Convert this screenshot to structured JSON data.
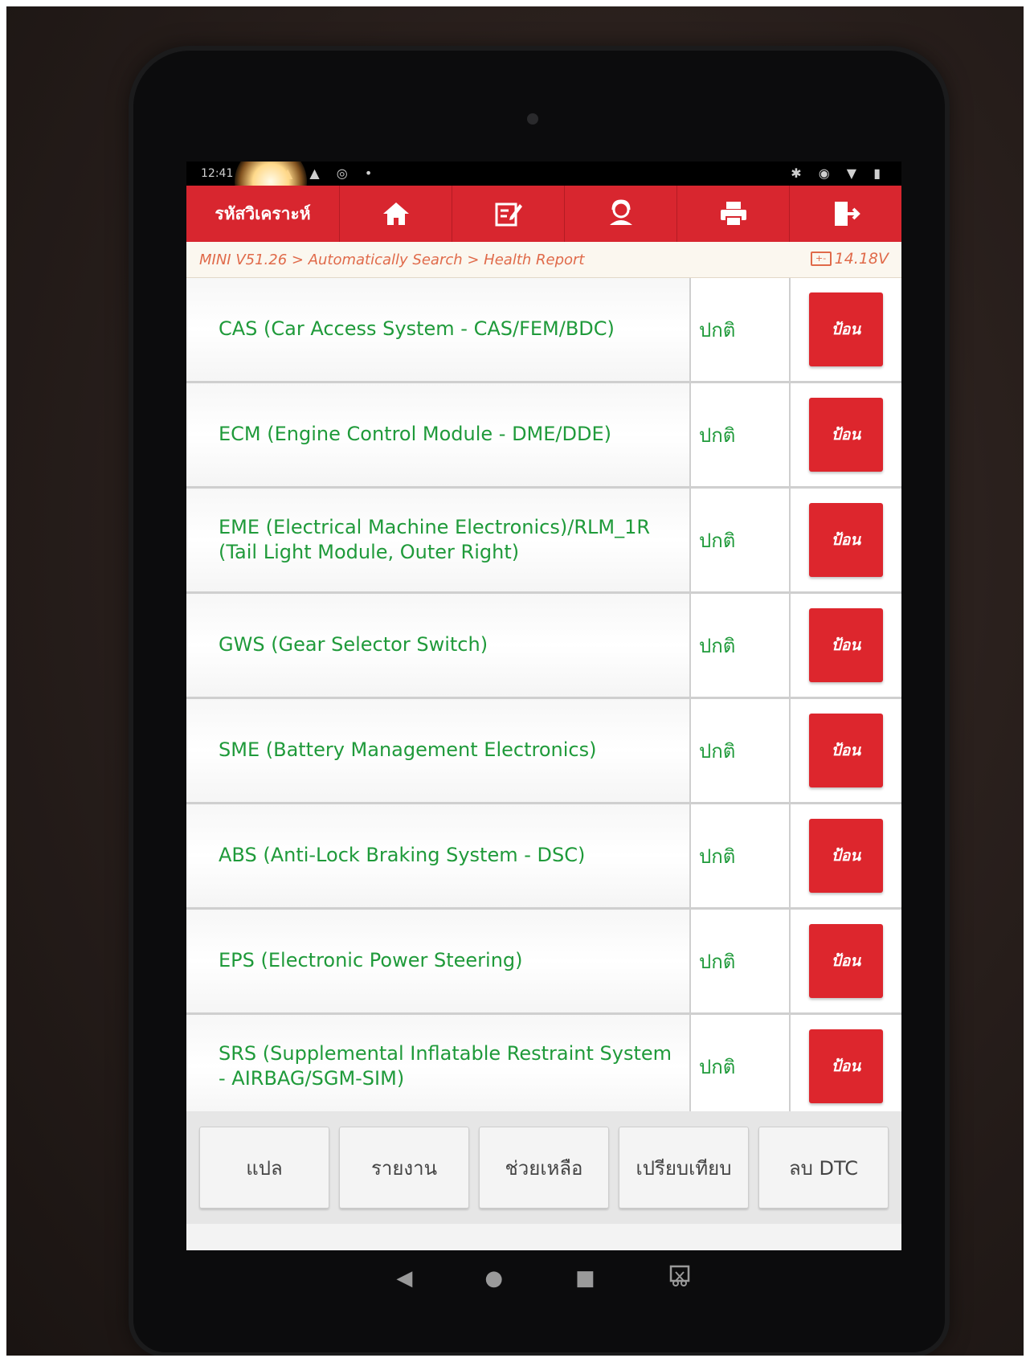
{
  "status_bar": {
    "time": "12:41",
    "left_icons": "▲ ▲ ◎ •",
    "right_icons": "✱ ◉ ▼ ▮"
  },
  "toolbar": {
    "title": "รหัสวิเคราะห์",
    "buttons": [
      {
        "icon": "home-icon"
      },
      {
        "icon": "edit-icon"
      },
      {
        "icon": "user-icon"
      },
      {
        "icon": "printer-icon"
      },
      {
        "icon": "exit-icon"
      }
    ],
    "colors": {
      "background": "#d8262f"
    }
  },
  "breadcrumb": {
    "path": "MINI V51.26 > Automatically Search > Health Report",
    "voltage": "14.18V",
    "battery_icon_text": "+-"
  },
  "systems": [
    {
      "name": "CAS (Car Access System - CAS/FEM/BDC)",
      "status": "ปกติ",
      "action": "ป้อน"
    },
    {
      "name": "ECM (Engine Control Module - DME/DDE)",
      "status": "ปกติ",
      "action": "ป้อน"
    },
    {
      "name": "EME (Electrical Machine Electronics)/RLM_1R (Tail Light Module, Outer Right)",
      "status": "ปกติ",
      "action": "ป้อน"
    },
    {
      "name": "GWS (Gear Selector Switch)",
      "status": "ปกติ",
      "action": "ป้อน"
    },
    {
      "name": "SME (Battery Management Electronics)",
      "status": "ปกติ",
      "action": "ป้อน"
    },
    {
      "name": "ABS (Anti-Lock Braking System - DSC)",
      "status": "ปกติ",
      "action": "ป้อน"
    },
    {
      "name": "EPS (Electronic Power Steering)",
      "status": "ปกติ",
      "action": "ป้อน"
    },
    {
      "name": "SRS (Supplemental Inflatable Restraint System - AIRBAG/SGM-SIM)",
      "status": "ปกติ",
      "action": "ป้อน"
    }
  ],
  "bottom_bar": {
    "buttons": [
      "แปล",
      "รายงาน",
      "ช่วยเหลือ",
      "เปรียบเทียบ",
      "ลบ DTC"
    ]
  },
  "nav_bar": {
    "icons": [
      "back-icon",
      "home-circle-icon",
      "recents-icon",
      "screenshot-icon"
    ]
  },
  "colors": {
    "accent_red": "#dd262d",
    "status_green": "#1f9a3a",
    "breadcrumb_orange": "#e06a4a"
  }
}
